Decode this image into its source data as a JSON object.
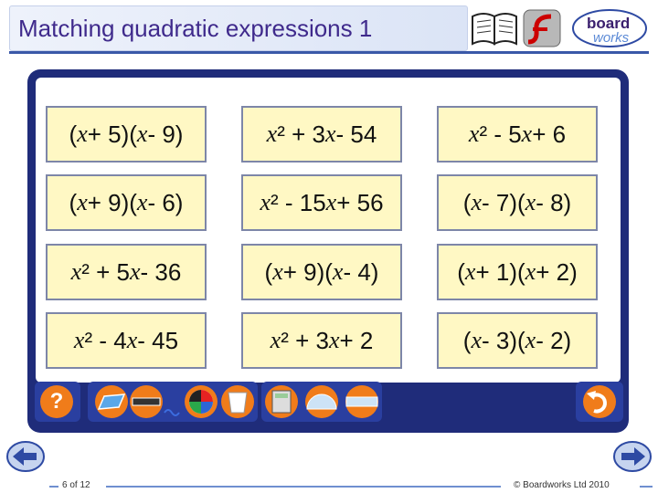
{
  "header": {
    "title": "Matching quadratic expressions 1",
    "logo_word_1": "board",
    "logo_word_2": "works"
  },
  "cards": [
    [
      "(x + 5)(x - 9)",
      "x² + 3x - 54",
      "x² - 5x + 6"
    ],
    [
      "(x + 9)(x - 6)",
      "x² - 15x + 56",
      "(x - 7)(x - 8)"
    ],
    [
      "x² + 5x - 36",
      "(x + 9)(x - 4)",
      "(x + 1)(x + 2)"
    ],
    [
      "x² - 4x - 45",
      "x² + 3x + 2",
      "(x - 3)(x - 2)"
    ]
  ],
  "toolbar": {
    "help_label": "?"
  },
  "footer": {
    "page_indicator": "6 of 12",
    "copyright": "© Boardworks Ltd 2010"
  },
  "colors": {
    "board": "#1f2c7a",
    "card_fill": "#fff8c4",
    "title": "#3f2a8c",
    "tool_orange": "#f07c1a"
  }
}
